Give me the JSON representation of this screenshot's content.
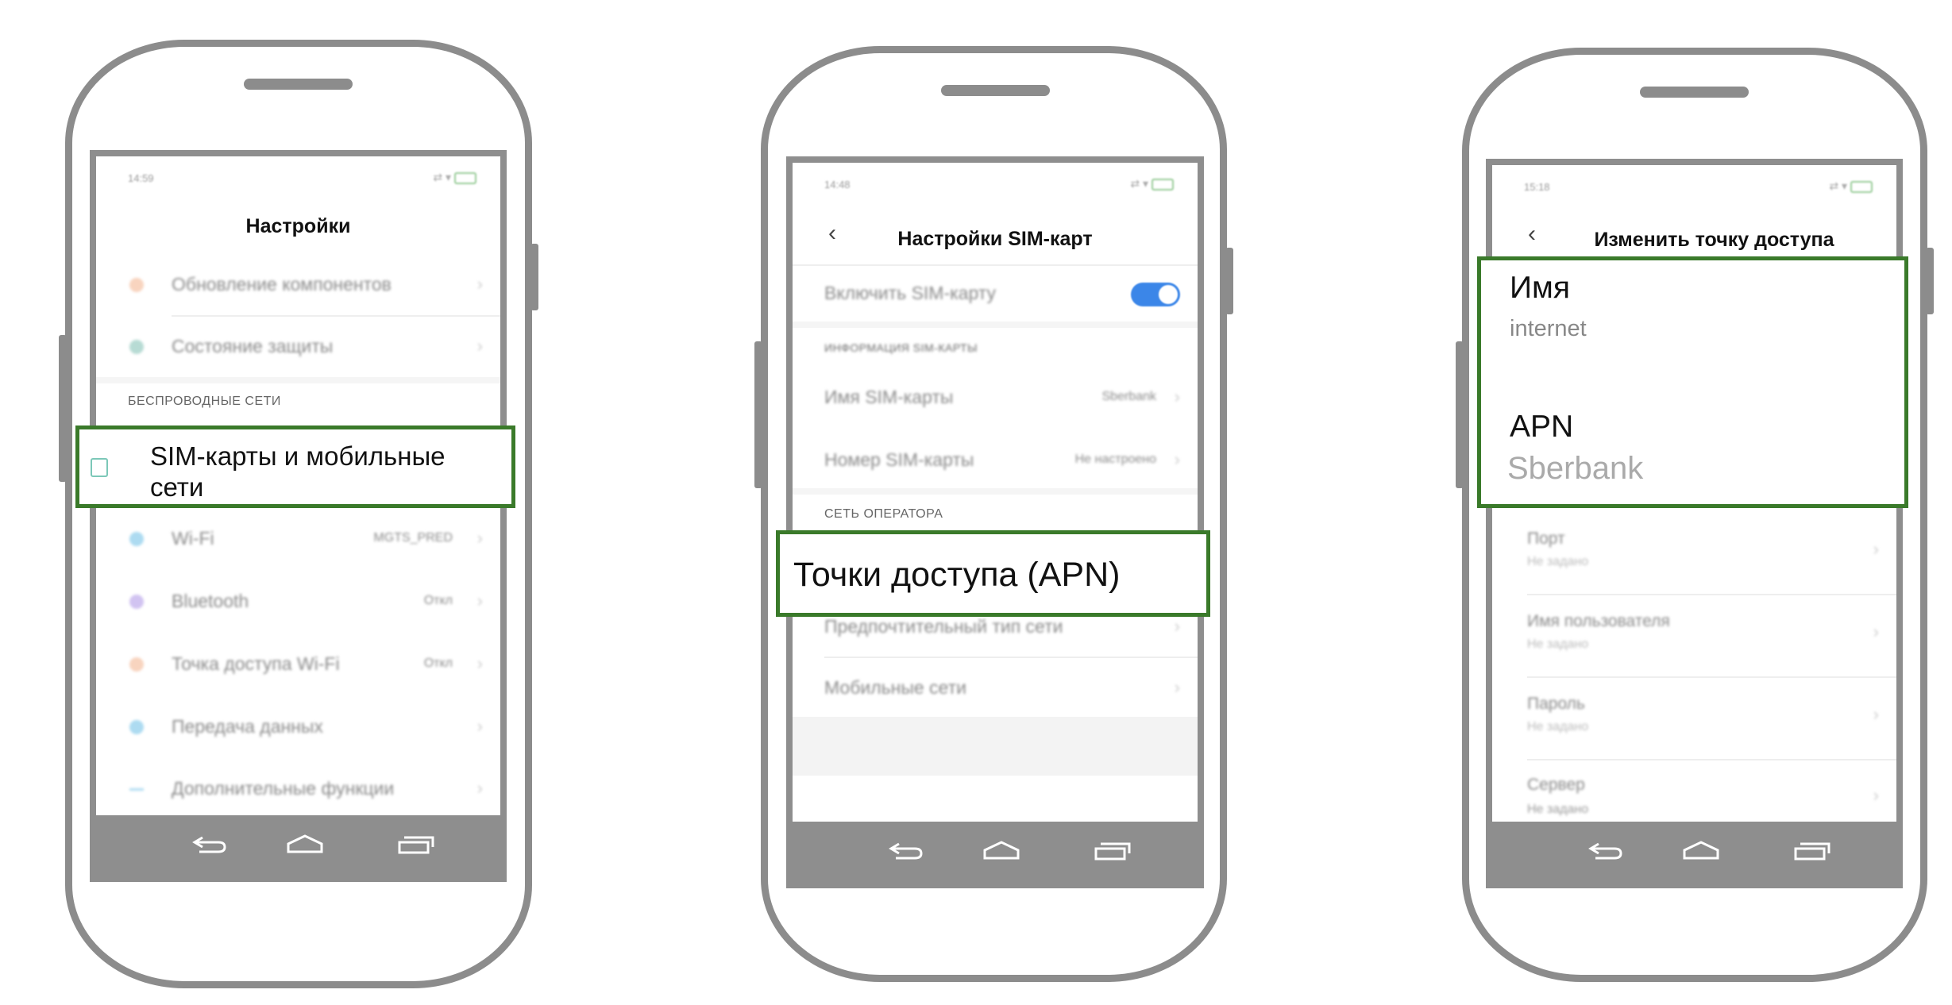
{
  "colors": {
    "highlight": "#3a7a2a",
    "phone_frame": "#8c8c8c",
    "toggle_on": "#3b86e8"
  },
  "phone1": {
    "time": "14:59",
    "title": "Настройки",
    "items_top": [
      {
        "label": "Обновление компонентов",
        "icon": "update-icon",
        "icon_color": "#f0a070"
      },
      {
        "label": "Состояние защиты",
        "icon": "shield-icon",
        "icon_color": "#60b0a0"
      }
    ],
    "section": "БЕСПРОВОДНЫЕ СЕТИ",
    "highlighted": {
      "label": "SIM-карты и мобильные сети",
      "icon": "sim-cards-icon"
    },
    "items": [
      {
        "label": "Wi-Fi",
        "value": "MGTS_PRED",
        "icon": "wifi-icon",
        "icon_color": "#4ab0e0"
      },
      {
        "label": "Bluetooth",
        "value": "Откл",
        "icon": "bluetooth-icon",
        "icon_color": "#9a7ae0"
      },
      {
        "label": "Точка доступа Wi-Fi",
        "value": "Откл",
        "icon": "hotspot-icon",
        "icon_color": "#f0a070"
      },
      {
        "label": "Передача данных",
        "value": "",
        "icon": "data-usage-icon",
        "icon_color": "#4ab0e0"
      },
      {
        "label": "Дополнительные функции",
        "value": "",
        "icon": "more-icon",
        "icon_color": "#4ab0e0"
      }
    ]
  },
  "phone2": {
    "time": "14:48",
    "title": "Настройки SIM-карт",
    "toggle": {
      "label": "Включить SIM-карту",
      "on": true
    },
    "section1": "ИНФОРМАЦИЯ SIM-КАРТЫ",
    "items1": [
      {
        "label": "Имя SIM-карты",
        "value": "Sberbank"
      },
      {
        "label": "Номер SIM-карты",
        "value": "Не настроено"
      }
    ],
    "section2": "СЕТЬ ОПЕРАТОРА",
    "highlighted": "Точки доступа (APN)",
    "items2": [
      {
        "label": "Предпочтительный тип сети"
      },
      {
        "label": "Мобильные сети"
      }
    ]
  },
  "phone3": {
    "time": "15:18",
    "title": "Изменить точку доступа",
    "highlighted": [
      {
        "label": "Имя",
        "value": "internet"
      },
      {
        "label": "APN",
        "value": "Sberbank"
      }
    ],
    "items": [
      {
        "label": "Порт",
        "value": "Не задано"
      },
      {
        "label": "Имя пользователя",
        "value": "Не задано"
      },
      {
        "label": "Пароль",
        "value": "Не задано"
      },
      {
        "label": "Сервер",
        "value": "Не задано"
      }
    ]
  }
}
